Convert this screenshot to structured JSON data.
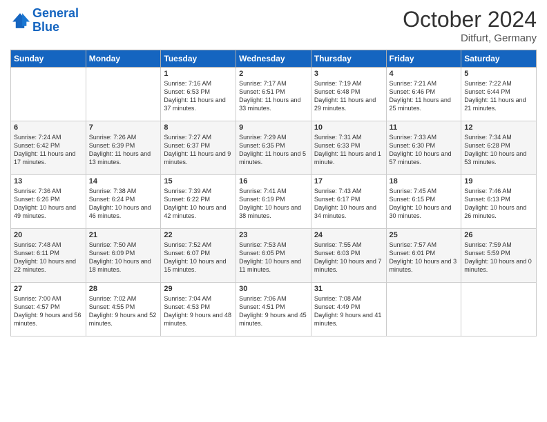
{
  "header": {
    "logo_line1": "General",
    "logo_line2": "Blue",
    "month": "October 2024",
    "location": "Ditfurt, Germany"
  },
  "weekdays": [
    "Sunday",
    "Monday",
    "Tuesday",
    "Wednesday",
    "Thursday",
    "Friday",
    "Saturday"
  ],
  "weeks": [
    [
      {
        "day": "",
        "content": ""
      },
      {
        "day": "",
        "content": ""
      },
      {
        "day": "1",
        "content": "Sunrise: 7:16 AM\nSunset: 6:53 PM\nDaylight: 11 hours and 37 minutes."
      },
      {
        "day": "2",
        "content": "Sunrise: 7:17 AM\nSunset: 6:51 PM\nDaylight: 11 hours and 33 minutes."
      },
      {
        "day": "3",
        "content": "Sunrise: 7:19 AM\nSunset: 6:48 PM\nDaylight: 11 hours and 29 minutes."
      },
      {
        "day": "4",
        "content": "Sunrise: 7:21 AM\nSunset: 6:46 PM\nDaylight: 11 hours and 25 minutes."
      },
      {
        "day": "5",
        "content": "Sunrise: 7:22 AM\nSunset: 6:44 PM\nDaylight: 11 hours and 21 minutes."
      }
    ],
    [
      {
        "day": "6",
        "content": "Sunrise: 7:24 AM\nSunset: 6:42 PM\nDaylight: 11 hours and 17 minutes."
      },
      {
        "day": "7",
        "content": "Sunrise: 7:26 AM\nSunset: 6:39 PM\nDaylight: 11 hours and 13 minutes."
      },
      {
        "day": "8",
        "content": "Sunrise: 7:27 AM\nSunset: 6:37 PM\nDaylight: 11 hours and 9 minutes."
      },
      {
        "day": "9",
        "content": "Sunrise: 7:29 AM\nSunset: 6:35 PM\nDaylight: 11 hours and 5 minutes."
      },
      {
        "day": "10",
        "content": "Sunrise: 7:31 AM\nSunset: 6:33 PM\nDaylight: 11 hours and 1 minute."
      },
      {
        "day": "11",
        "content": "Sunrise: 7:33 AM\nSunset: 6:30 PM\nDaylight: 10 hours and 57 minutes."
      },
      {
        "day": "12",
        "content": "Sunrise: 7:34 AM\nSunset: 6:28 PM\nDaylight: 10 hours and 53 minutes."
      }
    ],
    [
      {
        "day": "13",
        "content": "Sunrise: 7:36 AM\nSunset: 6:26 PM\nDaylight: 10 hours and 49 minutes."
      },
      {
        "day": "14",
        "content": "Sunrise: 7:38 AM\nSunset: 6:24 PM\nDaylight: 10 hours and 46 minutes."
      },
      {
        "day": "15",
        "content": "Sunrise: 7:39 AM\nSunset: 6:22 PM\nDaylight: 10 hours and 42 minutes."
      },
      {
        "day": "16",
        "content": "Sunrise: 7:41 AM\nSunset: 6:19 PM\nDaylight: 10 hours and 38 minutes."
      },
      {
        "day": "17",
        "content": "Sunrise: 7:43 AM\nSunset: 6:17 PM\nDaylight: 10 hours and 34 minutes."
      },
      {
        "day": "18",
        "content": "Sunrise: 7:45 AM\nSunset: 6:15 PM\nDaylight: 10 hours and 30 minutes."
      },
      {
        "day": "19",
        "content": "Sunrise: 7:46 AM\nSunset: 6:13 PM\nDaylight: 10 hours and 26 minutes."
      }
    ],
    [
      {
        "day": "20",
        "content": "Sunrise: 7:48 AM\nSunset: 6:11 PM\nDaylight: 10 hours and 22 minutes."
      },
      {
        "day": "21",
        "content": "Sunrise: 7:50 AM\nSunset: 6:09 PM\nDaylight: 10 hours and 18 minutes."
      },
      {
        "day": "22",
        "content": "Sunrise: 7:52 AM\nSunset: 6:07 PM\nDaylight: 10 hours and 15 minutes."
      },
      {
        "day": "23",
        "content": "Sunrise: 7:53 AM\nSunset: 6:05 PM\nDaylight: 10 hours and 11 minutes."
      },
      {
        "day": "24",
        "content": "Sunrise: 7:55 AM\nSunset: 6:03 PM\nDaylight: 10 hours and 7 minutes."
      },
      {
        "day": "25",
        "content": "Sunrise: 7:57 AM\nSunset: 6:01 PM\nDaylight: 10 hours and 3 minutes."
      },
      {
        "day": "26",
        "content": "Sunrise: 7:59 AM\nSunset: 5:59 PM\nDaylight: 10 hours and 0 minutes."
      }
    ],
    [
      {
        "day": "27",
        "content": "Sunrise: 7:00 AM\nSunset: 4:57 PM\nDaylight: 9 hours and 56 minutes."
      },
      {
        "day": "28",
        "content": "Sunrise: 7:02 AM\nSunset: 4:55 PM\nDaylight: 9 hours and 52 minutes."
      },
      {
        "day": "29",
        "content": "Sunrise: 7:04 AM\nSunset: 4:53 PM\nDaylight: 9 hours and 48 minutes."
      },
      {
        "day": "30",
        "content": "Sunrise: 7:06 AM\nSunset: 4:51 PM\nDaylight: 9 hours and 45 minutes."
      },
      {
        "day": "31",
        "content": "Sunrise: 7:08 AM\nSunset: 4:49 PM\nDaylight: 9 hours and 41 minutes."
      },
      {
        "day": "",
        "content": ""
      },
      {
        "day": "",
        "content": ""
      }
    ]
  ]
}
